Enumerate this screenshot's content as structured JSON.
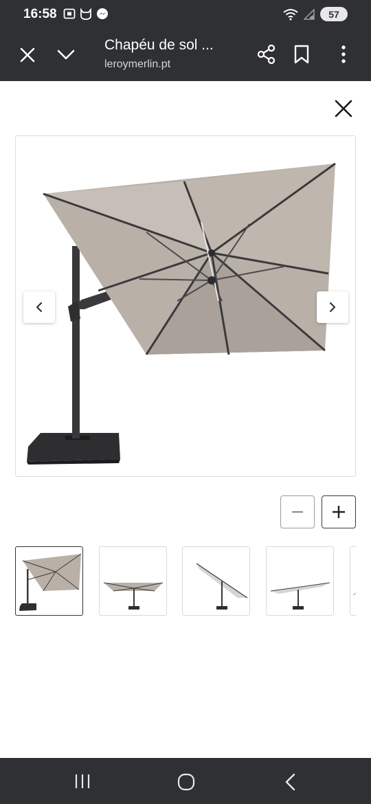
{
  "status_bar": {
    "time": "16:58",
    "battery": "57",
    "left_icons": [
      "screenshot-icon",
      "cat-app-icon",
      "messenger-icon"
    ],
    "right_icons": [
      "wifi-icon",
      "signal-icon"
    ]
  },
  "browser": {
    "title": "Chapéu de sol ...",
    "url": "leroymerlin.pt",
    "icons": [
      "close-icon",
      "chevron-down-icon",
      "share-icon",
      "bookmark-icon",
      "more-vert-icon"
    ]
  },
  "viewer": {
    "close_icon": "close-icon",
    "prev_icon": "chevron-left-icon",
    "next_icon": "chevron-right-icon",
    "zoom_out_icon": "minus-icon",
    "zoom_in_icon": "plus-icon",
    "thumbnail_count_visible": 5,
    "active_thumbnail": 1
  },
  "colors": {
    "bar_bg": "#2f3033",
    "canopy": "#b9b0a8",
    "frame": "#3a3a3c"
  },
  "system_nav": {
    "icons": [
      "recents-icon",
      "home-icon",
      "back-icon"
    ]
  }
}
